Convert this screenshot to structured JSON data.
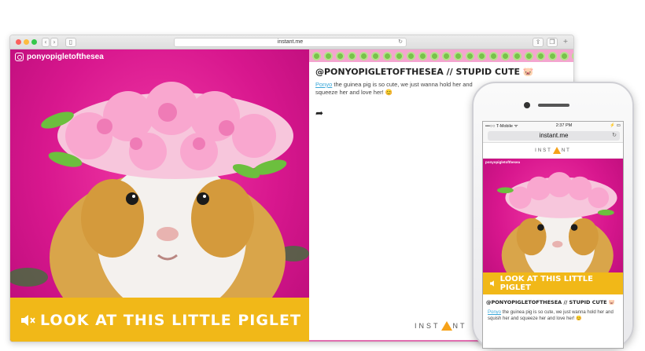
{
  "browser": {
    "url": "instant.me",
    "nav": {
      "back": "‹",
      "forward": "›"
    }
  },
  "post": {
    "handle": "ponyopigletofthesea",
    "caption": "LOOK AT THIS LITTLE PIGLET",
    "title": "@PONYOPIGLETOFTHESEA // STUPID CUTE 🐷",
    "body_link": "Ponyo",
    "body_text": " the guinea pig is so cute, we just wanna hold her and squish her and squeeze her and love her! 😊",
    "body_text_desktop": " the guinea pig is so cute, we just wanna hold her and squeeze her and love her! 😊"
  },
  "brand": {
    "prefix": "INST",
    "suffix": "NT"
  },
  "phone": {
    "carrier": "•••○○ T-Mobile ᯤ",
    "time": "2:37 PM",
    "battery": "⚡ ▭",
    "url": "instant.me",
    "brand_prefix": "INST",
    "brand_suffix": "NT"
  },
  "colors": {
    "magenta": "#d8178e",
    "mustard": "#f1b818",
    "pink_strip": "#f4a5cf",
    "green_dot": "#79c24a",
    "link": "#3aa7d8"
  },
  "icons": [
    "instagram-icon",
    "mute-icon",
    "share-arrow-icon",
    "reload-icon",
    "sidebar-icon",
    "share-icon",
    "tabs-icon",
    "add-tab-icon"
  ]
}
